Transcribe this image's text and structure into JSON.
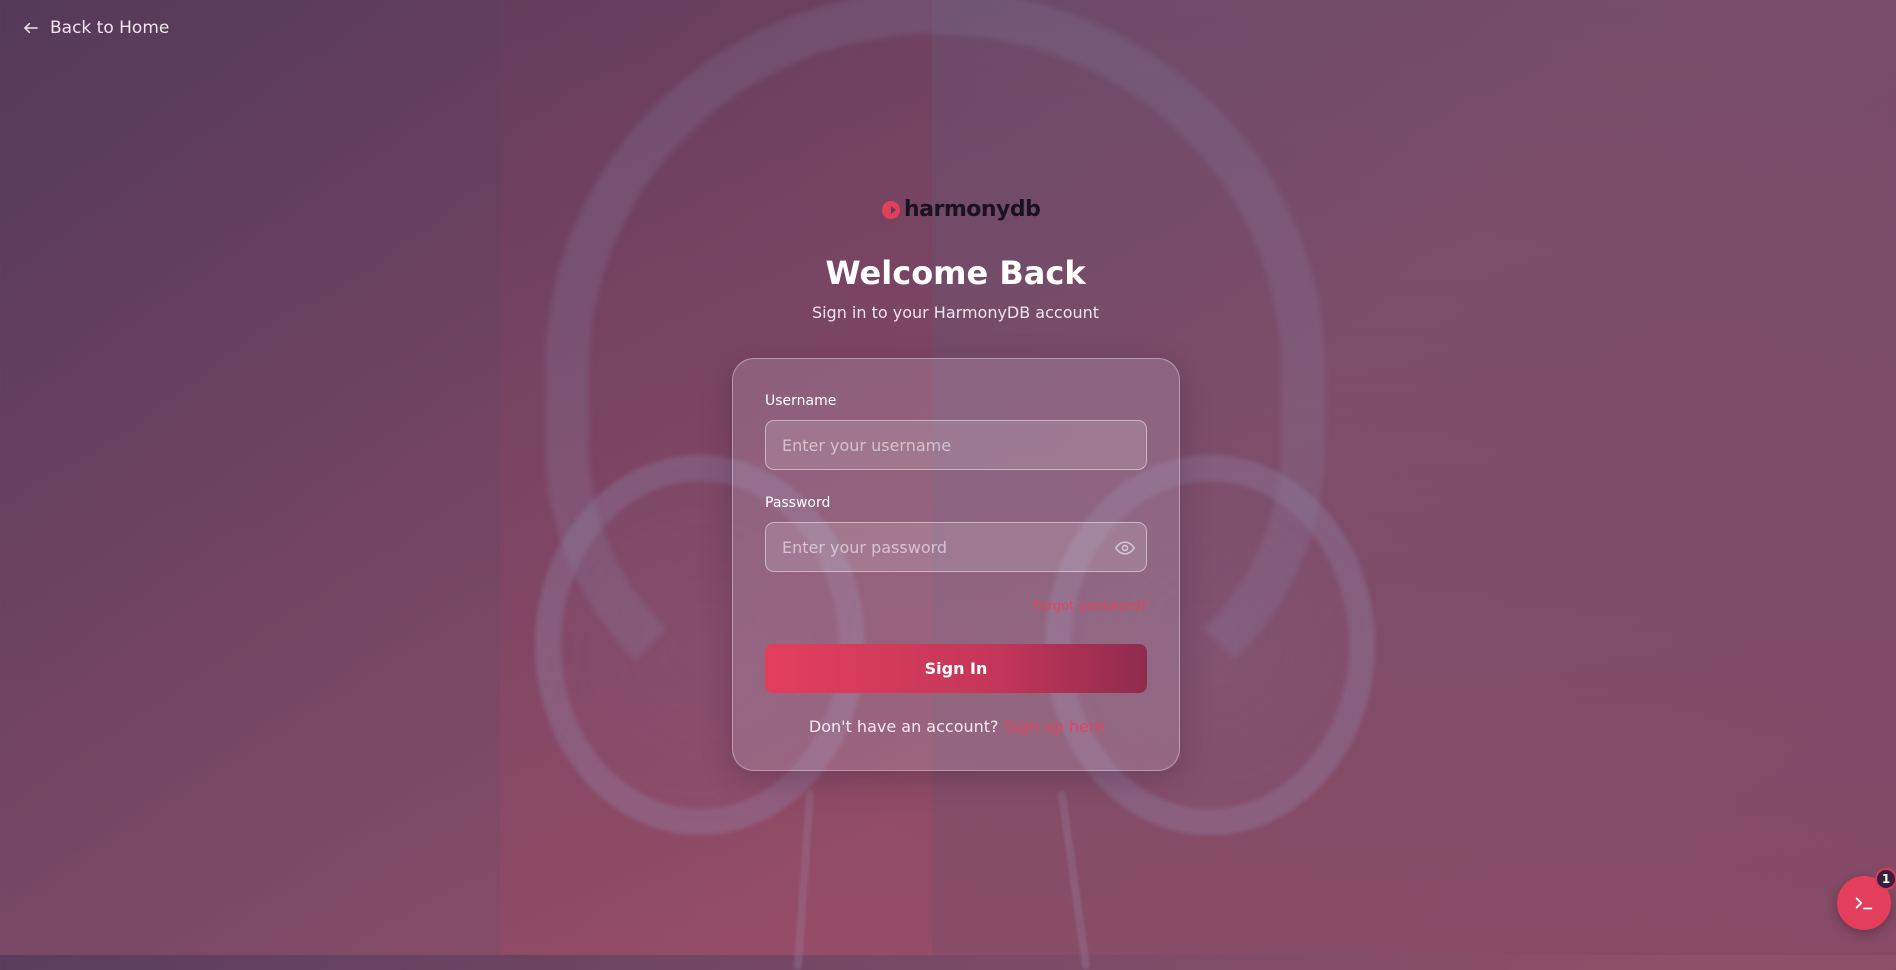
{
  "nav": {
    "back_label": "Back to Home"
  },
  "brand": {
    "name": "harmonydb",
    "accent": "#e33f5c"
  },
  "header": {
    "title": "Welcome Back",
    "subtitle": "Sign in to your HarmonyDB account"
  },
  "form": {
    "username_label": "Username",
    "username_placeholder": "Enter your username",
    "password_label": "Password",
    "password_placeholder": "Enter your password",
    "forgot_label": "Forgot password?",
    "submit_label": "Sign In",
    "signup_prompt": "Don't have an account?",
    "signup_link": "Sign up here"
  },
  "assistant": {
    "badge_count": "1",
    "icon": "terminal-icon"
  }
}
